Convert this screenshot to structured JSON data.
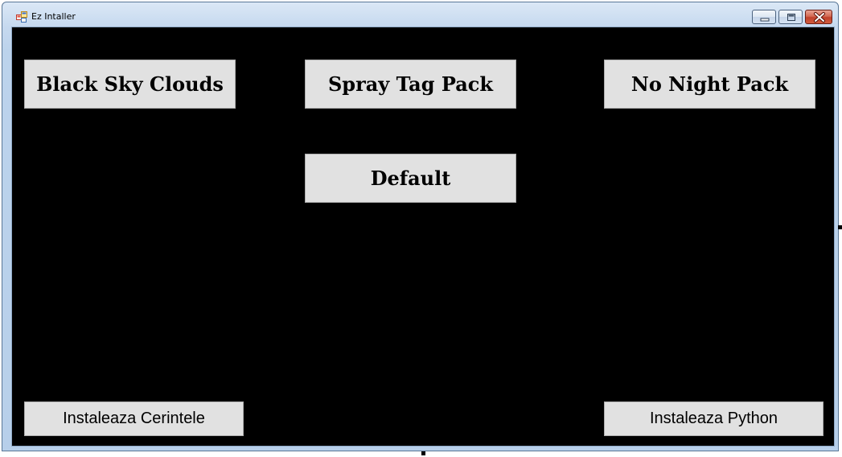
{
  "window": {
    "title": "Ez Intaller",
    "icon": "app-window-icon",
    "controls": {
      "minimize": "minimize-icon",
      "maximize": "maximize-icon",
      "close": "close-icon"
    }
  },
  "colors": {
    "client_background": "#000000",
    "button_face": "#e1e1e1",
    "button_border": "#adadad",
    "close_red": "#c0412b"
  },
  "buttons": {
    "black_sky_clouds": "Black Sky Clouds",
    "spray_tag_pack": "Spray Tag Pack",
    "no_night_pack": "No Night Pack",
    "default": "Default",
    "instaleaza_cerintele": "Instaleaza Cerintele",
    "instaleaza_python": "Instaleaza Python"
  }
}
